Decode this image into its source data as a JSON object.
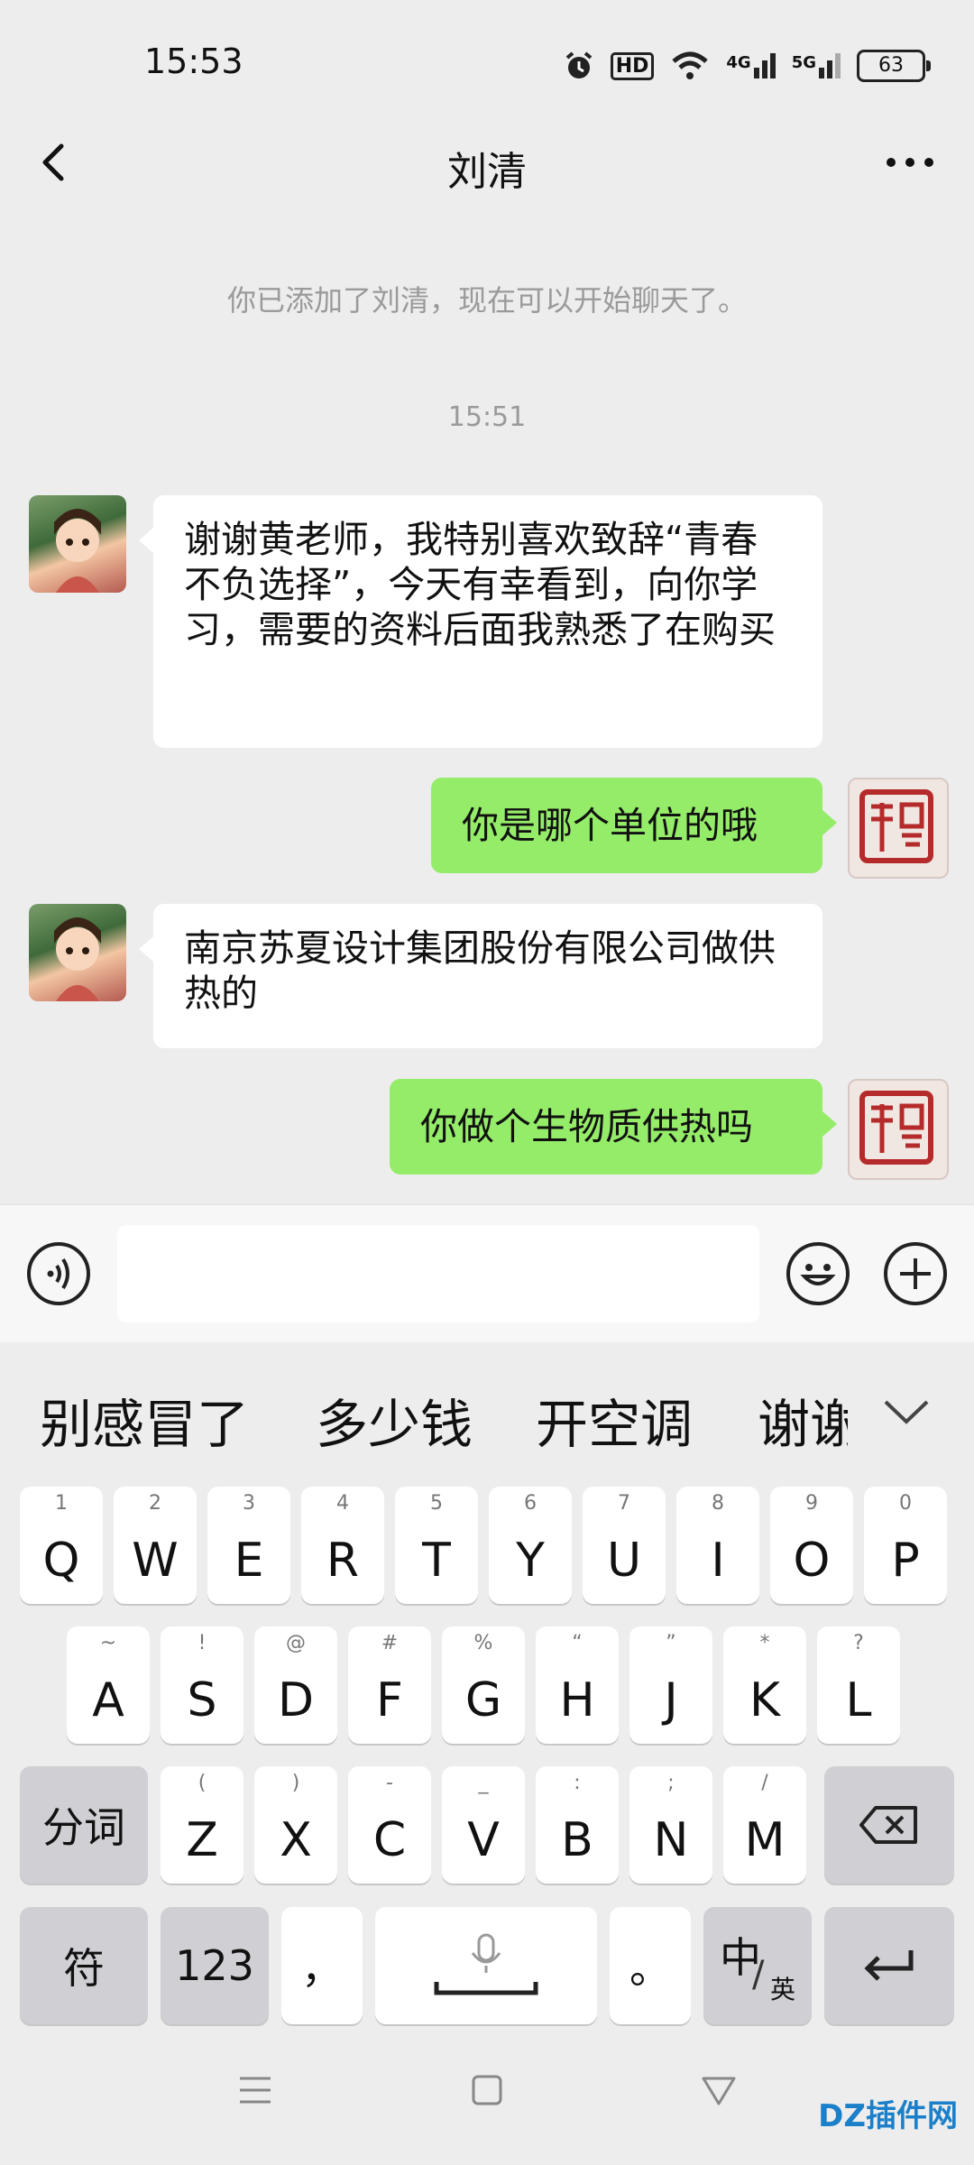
{
  "status_bar": {
    "time": "15:53",
    "battery": "63",
    "signal_labels": [
      "HD",
      "4G",
      "5G"
    ],
    "icons": [
      "alarm-icon",
      "hd-icon",
      "wifi-icon",
      "signal-4g-icon",
      "signal-5g-icon",
      "battery-icon"
    ]
  },
  "header": {
    "title": "刘清",
    "back_icon": "chevron-left-icon",
    "more_icon": "more-dots-icon"
  },
  "chat": {
    "system_message": "你已添加了刘清，现在可以开始聊天了。",
    "timestamp": "15:51",
    "messages": [
      {
        "side": "in",
        "text": "谢谢黄老师，我特别喜欢致辞“青春不负选择”，今天有幸看到，向你学习，需要的资料后面我熟悉了在购买"
      },
      {
        "side": "out",
        "text": "你是哪个单位的哦"
      },
      {
        "side": "in",
        "text": "南京苏夏设计集团股份有限公司做供热的"
      },
      {
        "side": "out",
        "text": "你做个生物质供热吗"
      }
    ]
  },
  "input_bar": {
    "voice_icon": "voice-icon",
    "emoji_icon": "emoji-icon",
    "plus_icon": "plus-icon",
    "value": ""
  },
  "suggestions": {
    "items": [
      "别感冒了",
      "多少钱",
      "开空调",
      "谢谢"
    ],
    "collapse_icon": "chevron-down-icon"
  },
  "keyboard": {
    "row1": [
      {
        "k": "Q",
        "s": "1"
      },
      {
        "k": "W",
        "s": "2"
      },
      {
        "k": "E",
        "s": "3"
      },
      {
        "k": "R",
        "s": "4"
      },
      {
        "k": "T",
        "s": "5"
      },
      {
        "k": "Y",
        "s": "6"
      },
      {
        "k": "U",
        "s": "7"
      },
      {
        "k": "I",
        "s": "8"
      },
      {
        "k": "O",
        "s": "9"
      },
      {
        "k": "P",
        "s": "0"
      }
    ],
    "row2": [
      {
        "k": "A",
        "s": "~"
      },
      {
        "k": "S",
        "s": "!"
      },
      {
        "k": "D",
        "s": "@"
      },
      {
        "k": "F",
        "s": "#"
      },
      {
        "k": "G",
        "s": "%"
      },
      {
        "k": "H",
        "s": "“"
      },
      {
        "k": "J",
        "s": "”"
      },
      {
        "k": "K",
        "s": "*"
      },
      {
        "k": "L",
        "s": "?"
      }
    ],
    "row3": [
      {
        "k": "Z",
        "s": "("
      },
      {
        "k": "X",
        "s": ")"
      },
      {
        "k": "C",
        "s": "-"
      },
      {
        "k": "V",
        "s": "_"
      },
      {
        "k": "B",
        "s": ":"
      },
      {
        "k": "N",
        "s": ";"
      },
      {
        "k": "M",
        "s": "/"
      }
    ],
    "split_label": "分词",
    "symbol_label": "符",
    "num_label": "123",
    "comma_label": "，",
    "period_label": "。",
    "lang_label_main": "中",
    "lang_label_sub": "英",
    "lang_label_slash": "/",
    "backspace_icon": "backspace-icon",
    "mic_icon": "mic-icon",
    "enter_icon": "enter-icon"
  },
  "system_nav": {
    "icons": [
      "menu-icon",
      "home-square-icon",
      "back-triangle-icon"
    ]
  },
  "watermark": "DZ插件网"
}
